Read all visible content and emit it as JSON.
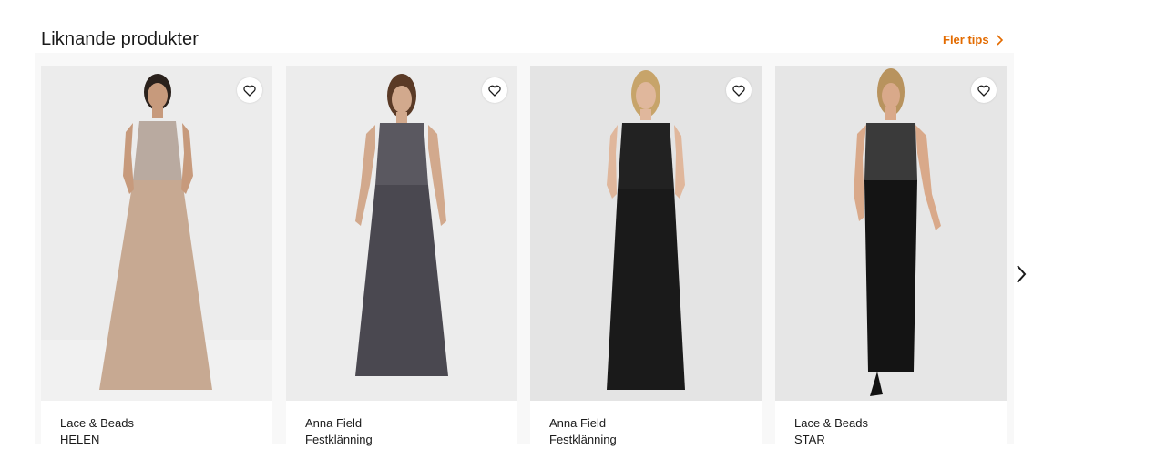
{
  "section": {
    "title": "Liknande produkter",
    "more_link": "Fler tips",
    "accent_color": "#e36b00"
  },
  "products": [
    {
      "brand": "Lace & Beads",
      "name": "HELEN",
      "dress_color": "#c7a992",
      "bodice_color": "#b9aaa0"
    },
    {
      "brand": "Anna Field",
      "name": "Festklänning",
      "dress_color": "#4a4850",
      "bodice_color": "#5a5860"
    },
    {
      "brand": "Anna Field",
      "name": "Festklänning",
      "dress_color": "#1a1a1a",
      "bodice_color": "#222222"
    },
    {
      "brand": "Lace & Beads",
      "name": "STAR",
      "dress_color": "#141414",
      "bodice_color": "#3a3a3a"
    }
  ],
  "icons": {
    "favorite": "heart-outline-icon",
    "next": "chevron-right-icon",
    "more": "chevron-right-icon"
  }
}
